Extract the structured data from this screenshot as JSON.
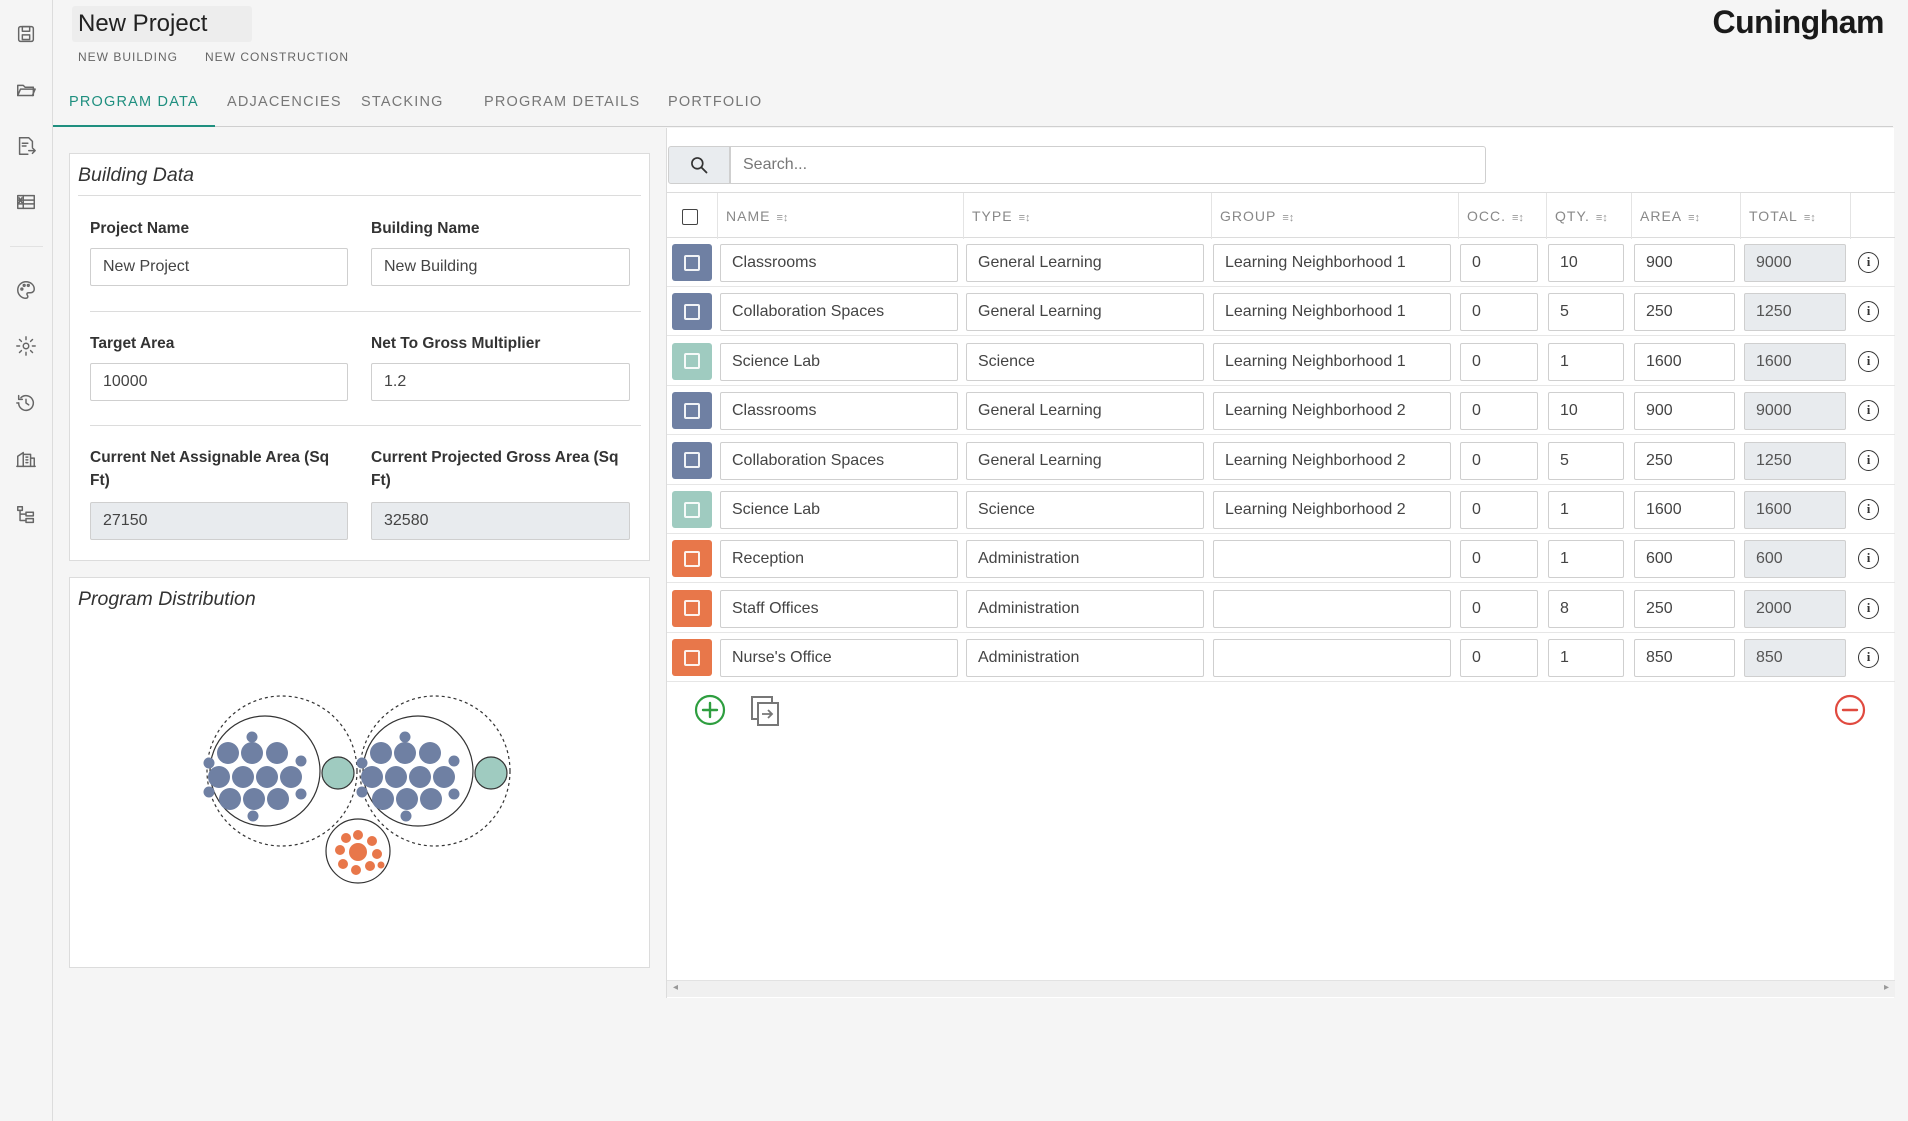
{
  "header": {
    "project_title": "New Project",
    "subtitle_building": "NEW BUILDING",
    "subtitle_construction": "NEW CONSTRUCTION",
    "brand": "Cuningham"
  },
  "rail": {
    "icons": [
      "save-icon",
      "folder-open-icon",
      "export-icon",
      "excel-icon",
      "palette-icon",
      "gear-icon",
      "history-icon",
      "buildings-icon",
      "hierarchy-icon"
    ]
  },
  "tabs": [
    {
      "label": "PROGRAM DATA",
      "active": true
    },
    {
      "label": "ADJACENCIES",
      "active": false
    },
    {
      "label": "STACKING",
      "active": false
    },
    {
      "label": "PROGRAM DETAILS",
      "active": false
    },
    {
      "label": "PORTFOLIO",
      "active": false
    }
  ],
  "building_data": {
    "title": "Building Data",
    "project_name_label": "Project Name",
    "project_name_value": "New Project",
    "building_name_label": "Building Name",
    "building_name_value": "New Building",
    "target_area_label": "Target Area",
    "target_area_value": "10000",
    "multiplier_label": "Net To Gross Multiplier",
    "multiplier_value": "1.2",
    "net_area_label": "Current Net Assignable Area (Sq Ft)",
    "net_area_value": "27150",
    "gross_area_label": "Current Projected Gross Area (Sq Ft)",
    "gross_area_value": "32580"
  },
  "distribution": {
    "title": "Program Distribution"
  },
  "search": {
    "placeholder": "Search..."
  },
  "table": {
    "columns": [
      "NAME",
      "TYPE",
      "GROUP",
      "OCC.",
      "QTY.",
      "AREA",
      "TOTAL"
    ],
    "rows": [
      {
        "color": "#6f80a3",
        "name": "Classrooms",
        "type": "General Learning",
        "group": "Learning Neighborhood 1",
        "occ": "0",
        "qty": "10",
        "area": "900",
        "total": "9000"
      },
      {
        "color": "#6f80a3",
        "name": "Collaboration Spaces",
        "type": "General Learning",
        "group": "Learning Neighborhood 1",
        "occ": "0",
        "qty": "5",
        "area": "250",
        "total": "1250"
      },
      {
        "color": "#9fcbc0",
        "name": "Science Lab",
        "type": "Science",
        "group": "Learning Neighborhood 1",
        "occ": "0",
        "qty": "1",
        "area": "1600",
        "total": "1600"
      },
      {
        "color": "#6f80a3",
        "name": "Classrooms",
        "type": "General Learning",
        "group": "Learning Neighborhood 2",
        "occ": "0",
        "qty": "10",
        "area": "900",
        "total": "9000"
      },
      {
        "color": "#6f80a3",
        "name": "Collaboration Spaces",
        "type": "General Learning",
        "group": "Learning Neighborhood 2",
        "occ": "0",
        "qty": "5",
        "area": "250",
        "total": "1250"
      },
      {
        "color": "#9fcbc0",
        "name": "Science Lab",
        "type": "Science",
        "group": "Learning Neighborhood 2",
        "occ": "0",
        "qty": "1",
        "area": "1600",
        "total": "1600"
      },
      {
        "color": "#e8774a",
        "name": "Reception",
        "type": "Administration",
        "group": "",
        "occ": "0",
        "qty": "1",
        "area": "600",
        "total": "600"
      },
      {
        "color": "#e8774a",
        "name": "Staff Offices",
        "type": "Administration",
        "group": "",
        "occ": "0",
        "qty": "8",
        "area": "250",
        "total": "2000"
      },
      {
        "color": "#e8774a",
        "name": "Nurse's Office",
        "type": "Administration",
        "group": "",
        "occ": "0",
        "qty": "1",
        "area": "850",
        "total": "850"
      }
    ]
  },
  "colors": {
    "accent": "#1f8f7f",
    "general_learning": "#6f80a3",
    "science": "#9fcbc0",
    "administration": "#e8774a",
    "add": "#2e9e3f",
    "remove": "#e04a3f"
  }
}
